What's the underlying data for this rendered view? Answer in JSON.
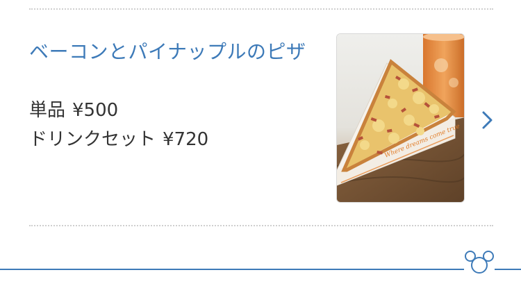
{
  "menu_item": {
    "title": "ベーコンとパイナップルのピザ",
    "single": {
      "label": "単品",
      "price": "¥500"
    },
    "set": {
      "label": "ドリンクセット",
      "price": "¥720"
    },
    "image_icon": "pizza-slice-photo",
    "chevron_icon": "chevron-right-icon",
    "box_print": "Where dreams come true"
  },
  "footer": {
    "icon": "mickey-head-icon"
  },
  "colors": {
    "accent": "#3d7ab8",
    "text": "#333333",
    "divider": "#cfcfcf"
  }
}
